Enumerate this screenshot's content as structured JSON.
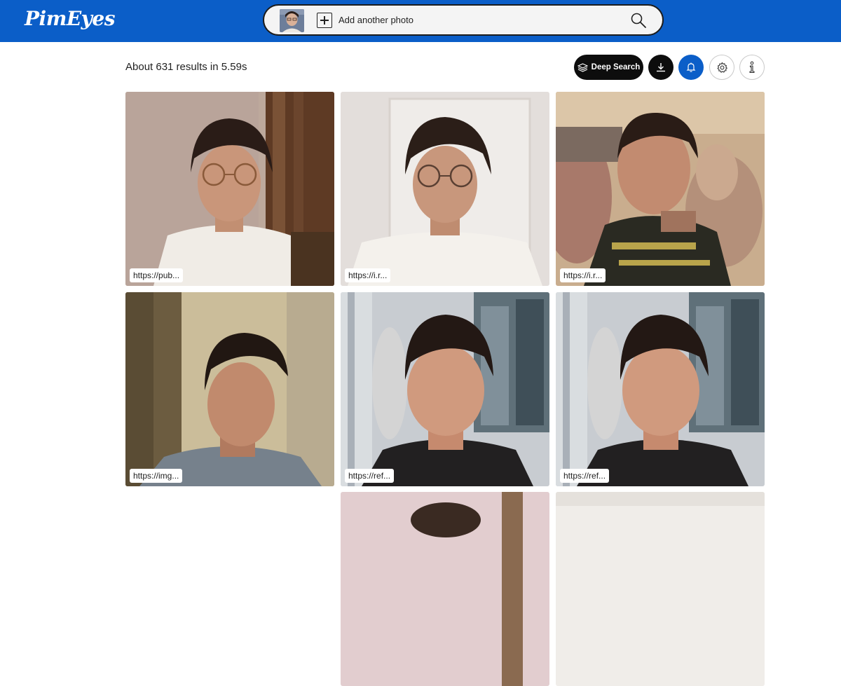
{
  "header": {
    "logo": "PimEyes",
    "search": {
      "add_label": "Add another photo"
    }
  },
  "toolbar": {
    "results_text": "About 631 results in 5.59s",
    "deep_search_label": "Deep Search"
  },
  "results": [
    {
      "url": "https://pub..."
    },
    {
      "url": "https://i.r..."
    },
    {
      "url": "https://i.r..."
    },
    {
      "url": "https://img..."
    },
    {
      "url": "https://ref..."
    },
    {
      "url": "https://ref..."
    },
    {
      "url": ""
    },
    {
      "url": ""
    }
  ],
  "colors": {
    "brand_blue": "#0b5ec8",
    "dark_button": "#0d0d0d"
  },
  "icons": [
    "add-photo-icon",
    "search-icon",
    "layers-icon",
    "download-icon",
    "bell-icon",
    "gear-icon",
    "info-icon"
  ]
}
